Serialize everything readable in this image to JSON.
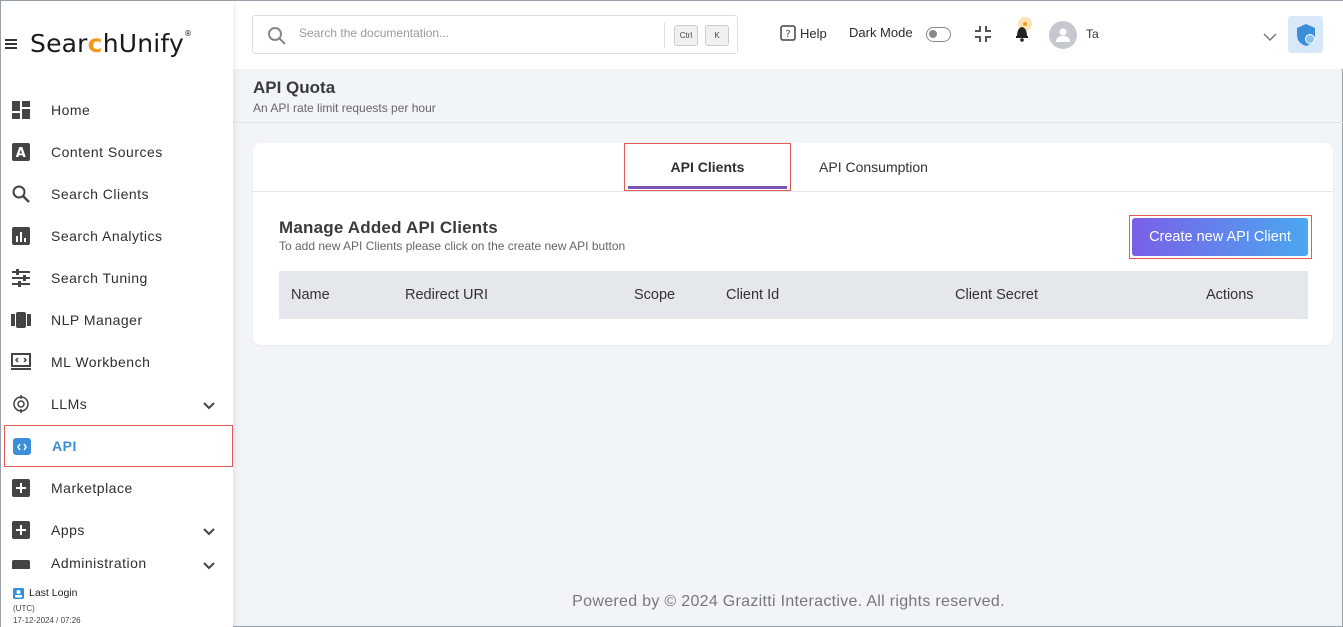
{
  "brand": {
    "name_before": "Sear",
    "name_mark": "c",
    "name_after": "hUnify",
    "trademark": "®"
  },
  "sidebar": {
    "items": [
      {
        "label": "Home",
        "icon": "dashboard-icon"
      },
      {
        "label": "Content Sources",
        "icon": "letter-a-icon"
      },
      {
        "label": "Search Clients",
        "icon": "search-icon"
      },
      {
        "label": "Search Analytics",
        "icon": "bar-chart-icon"
      },
      {
        "label": "Search Tuning",
        "icon": "sliders-icon"
      },
      {
        "label": "NLP Manager",
        "icon": "nlp-icon"
      },
      {
        "label": "ML Workbench",
        "icon": "workbench-icon"
      },
      {
        "label": "LLMs",
        "icon": "brain-icon"
      },
      {
        "label": "API",
        "icon": "api-code-icon"
      },
      {
        "label": "Marketplace",
        "icon": "plus-box-icon"
      },
      {
        "label": "Apps",
        "icon": "plus-box-icon"
      },
      {
        "label": "Administration",
        "icon": "admin-icon"
      }
    ],
    "last_login": {
      "label": "Last Login",
      "timezone": "(UTC)",
      "datetime": "17-12-2024 / 07:26"
    }
  },
  "topbar": {
    "search_placeholder": "Search the documentation...",
    "kbd_ctrl": "Ctrl",
    "kbd_k": "K",
    "help_label": "Help",
    "dark_mode_label": "Dark Mode",
    "user_name": "Ta"
  },
  "page": {
    "title": "API Quota",
    "subtitle": "An API rate limit requests per hour"
  },
  "tabs": {
    "clients": "API Clients",
    "consumption": "API Consumption"
  },
  "manage": {
    "title": "Manage Added API Clients",
    "subtitle": "To add new API Clients please click on the create new API button",
    "create_button": "Create new API Client"
  },
  "table": {
    "columns": [
      "Name",
      "Redirect URI",
      "Scope",
      "Client Id",
      "Client Secret",
      "Actions"
    ]
  },
  "footer": "Powered by © 2024 Grazitti Interactive. All rights reserved.",
  "colors": {
    "accent": "#3a8fd8",
    "highlight": "#e05a5a",
    "tab_underline": "#7a55b8"
  }
}
